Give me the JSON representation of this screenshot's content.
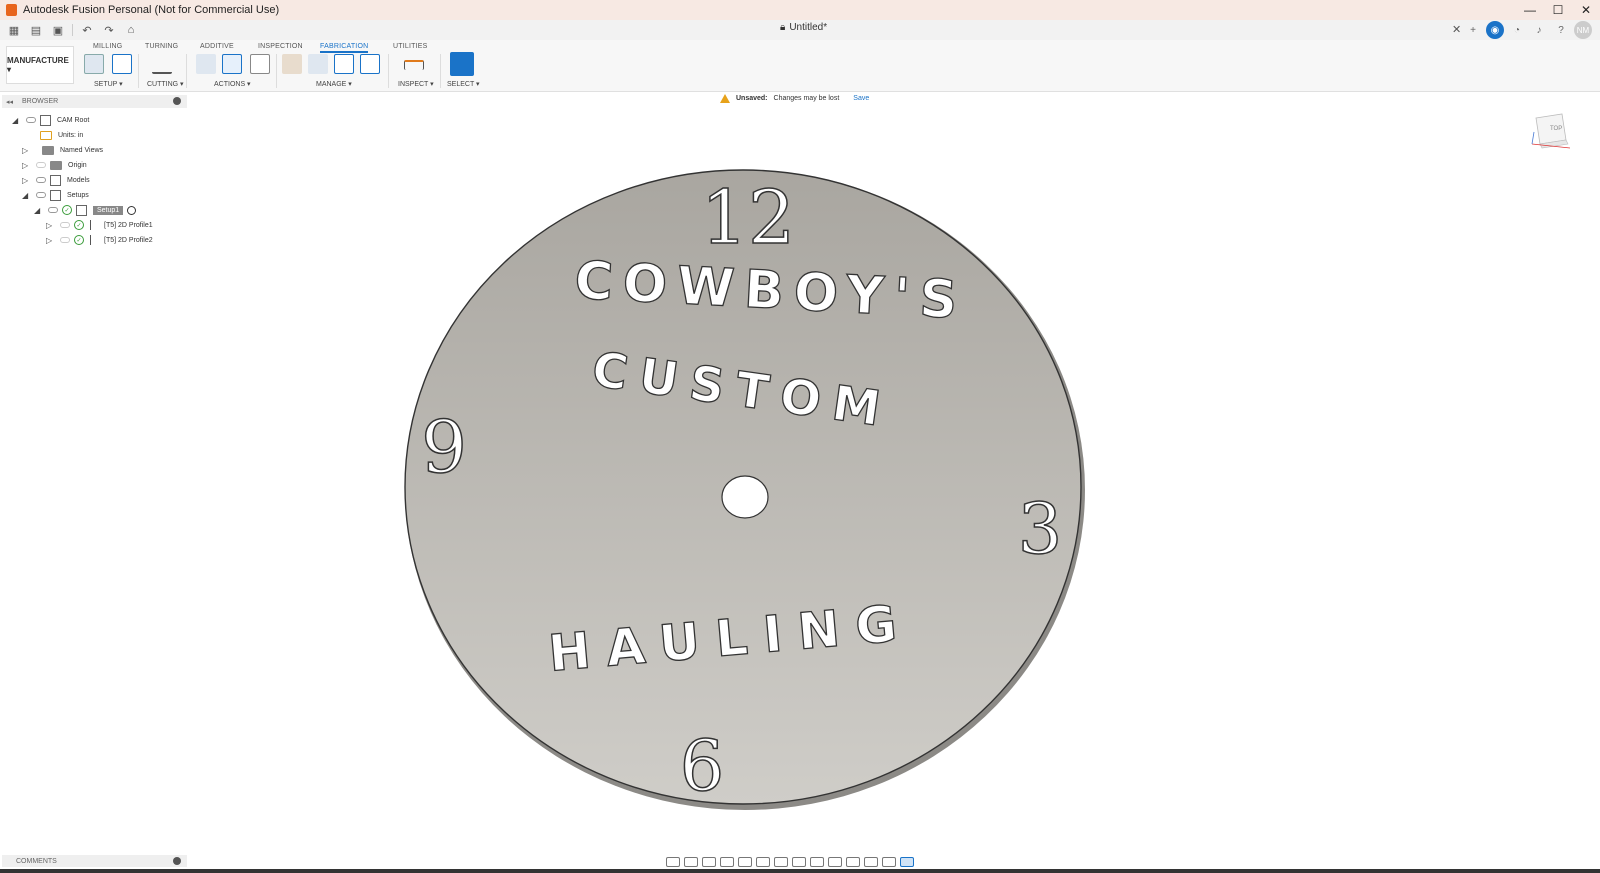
{
  "window": {
    "title": "Autodesk Fusion Personal (Not for Commercial Use)",
    "controls": [
      "—",
      "☐",
      "✕"
    ]
  },
  "document": {
    "tab_title": "Untitled*",
    "close_glyph": "✕"
  },
  "user": {
    "initials": "NM"
  },
  "ribbon": {
    "workspace": "MANUFACTURE ▾",
    "tabs": [
      "MILLING",
      "TURNING",
      "ADDITIVE",
      "INSPECTION",
      "FABRICATION",
      "UTILITIES"
    ],
    "active_tab": "FABRICATION",
    "groups": [
      "SETUP ▾",
      "CUTTING ▾",
      "ACTIONS ▾",
      "MANAGE ▾",
      "INSPECT ▾",
      "SELECT ▾"
    ]
  },
  "browser": {
    "header": "BROWSER",
    "items": [
      {
        "label": "CAM Root"
      },
      {
        "label": "Units: in"
      },
      {
        "label": "Named Views"
      },
      {
        "label": "Origin"
      },
      {
        "label": "Models"
      },
      {
        "label": "Setups"
      },
      {
        "label": "Setup1"
      },
      {
        "label": "[T5] 2D Profile1"
      },
      {
        "label": "[T5] 2D Profile2"
      }
    ]
  },
  "notification": {
    "label": "Unsaved:",
    "message": "Changes may be lost",
    "action": "Save"
  },
  "viewcube": {
    "face": "TOP"
  },
  "model": {
    "numbers": [
      "12",
      "3",
      "6",
      "9"
    ],
    "line1": "COWBOY'S",
    "line2": "CUSTOM",
    "line3": "HAULING"
  },
  "comments": {
    "label": "COMMENTS"
  },
  "colors": {
    "accent": "#1a73c8",
    "disc": "#bcbab4",
    "warning": "#e7a21a"
  }
}
